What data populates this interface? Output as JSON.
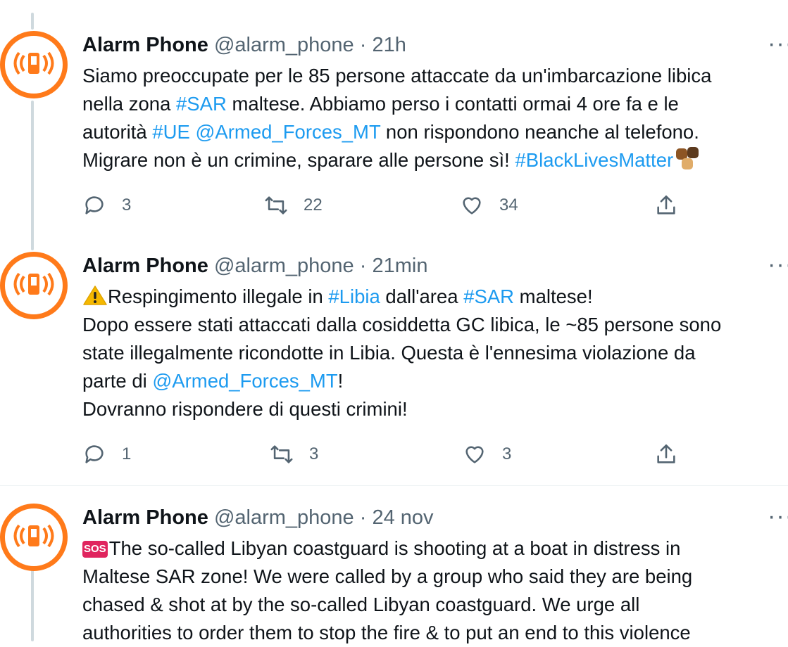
{
  "colors": {
    "accent": "#1d9bf0",
    "avatar_ring": "#ff7a1a",
    "muted": "#536471"
  },
  "more_label": "···",
  "tweets": [
    {
      "name": "Alarm Phone",
      "handle": "@alarm_phone",
      "separator": "·",
      "time": "21h",
      "text": {
        "l1": "Siamo preoccupate per le 85 persone attaccate da un'imbarcazione libica",
        "l2a": "nella zona ",
        "l2b": "#SAR",
        "l2c": " maltese. Abbiamo perso i contatti ormai 4 ore fa e le",
        "l3a": "autorità ",
        "l3b": "#UE",
        "l3c": " ",
        "l3d": "@Armed_Forces_MT",
        "l3e": " non rispondono neanche al telefono.",
        "l4a": "Migrare non è un crimine, sparare alle persone sì! ",
        "l4b": "#BlackLivesMatter"
      },
      "reply_count": "3",
      "retweet_count": "22",
      "like_count": "34"
    },
    {
      "name": "Alarm Phone",
      "handle": "@alarm_phone",
      "separator": "·",
      "time": "21min",
      "text": {
        "l1a": "Respingimento illegale in ",
        "l1b": "#Libia",
        "l1c": " dall'area ",
        "l1d": "#SAR",
        "l1e": " maltese!",
        "l2": "Dopo essere stati attaccati dalla cosiddetta GC libica, le ~85 persone sono",
        "l3": "state illegalmente ricondotte in Libia. Questa è l'ennesima violazione da",
        "l4a": "parte di ",
        "l4b": "@Armed_Forces_MT",
        "l4c": "!",
        "l5": "Dovranno rispondere di questi crimini!"
      },
      "reply_count": "1",
      "retweet_count": "3",
      "like_count": "3"
    },
    {
      "name": "Alarm Phone",
      "handle": "@alarm_phone",
      "separator": "·",
      "time": "24 nov",
      "text": {
        "sos": "SOS",
        "l1": "The so-called Libyan coastguard is shooting at a boat in distress in",
        "l2": "Maltese SAR zone! We were called by a group who said they are being",
        "l3": "chased & shot at by the so-called Libyan coastguard. We urge all",
        "l4": "authorities to order them to stop the fire & to put an end to this violence"
      }
    }
  ]
}
